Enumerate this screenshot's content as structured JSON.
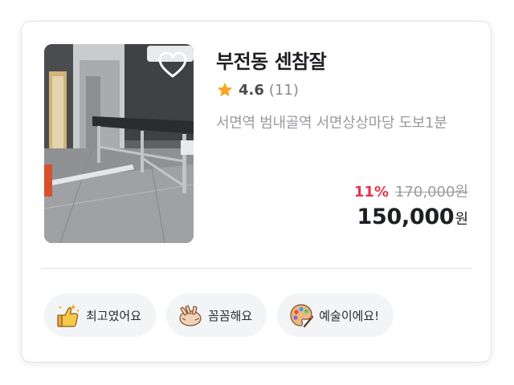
{
  "listing": {
    "title": "부전동 센참잘",
    "rating": "4.6",
    "review_count": "(11)",
    "location": "서면역 범내골역 서면상상마당 도보1분",
    "discount_percent": "11%",
    "original_price": "170,000원",
    "final_price": "150,000",
    "currency": "원",
    "favorite_icon": "heart-outline-icon",
    "rating_icon": "star-icon",
    "star_color": "#f5a623",
    "discount_color": "#e8344b"
  },
  "reviews": {
    "chips": [
      {
        "label": "최고였어요",
        "icon": "thumbs-up-sparkle-icon"
      },
      {
        "label": "꼼꼼해요",
        "icon": "massage-hands-icon"
      },
      {
        "label": "예술이에요!",
        "icon": "palette-icon"
      }
    ]
  }
}
